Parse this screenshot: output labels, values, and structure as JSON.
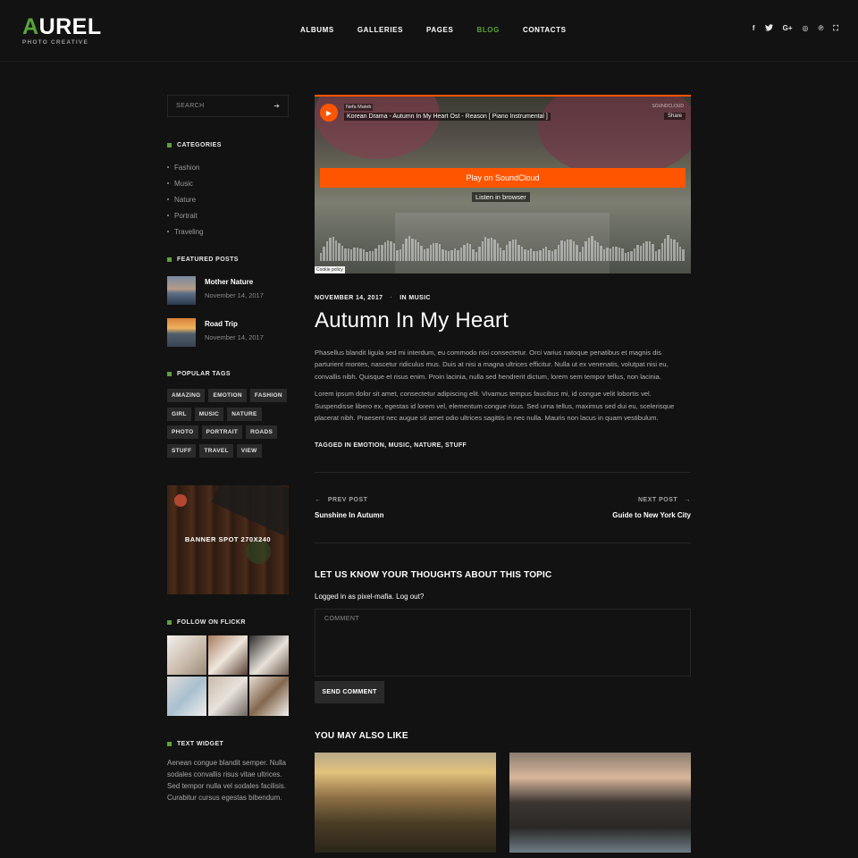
{
  "header": {
    "logo_first": "A",
    "logo_rest": "UREL",
    "logo_sub": "PHOTO CREATIVE",
    "nav": [
      {
        "label": "ALBUMS",
        "active": false
      },
      {
        "label": "GALLERIES",
        "active": false
      },
      {
        "label": "PAGES",
        "active": false
      },
      {
        "label": "BLOG",
        "active": true
      },
      {
        "label": "CONTACTS",
        "active": false
      }
    ],
    "social": {
      "facebook": "f",
      "twitter": "t",
      "google": "G+",
      "instagram": "◎",
      "pinterest": "℗",
      "fullscreen": "⛶"
    }
  },
  "sidebar": {
    "search_placeholder": "SEARCH",
    "search_arrow": "➔",
    "categories_title": "CATEGORIES",
    "categories": [
      "Fashion",
      "Music",
      "Nature",
      "Portrait",
      "Traveling"
    ],
    "featured_title": "FEATURED POSTS",
    "featured": [
      {
        "title": "Mother Nature",
        "date": "November 14, 2017"
      },
      {
        "title": "Road Trip",
        "date": "November 14, 2017"
      }
    ],
    "tags_title": "POPULAR TAGS",
    "tags": [
      "AMAZING",
      "EMOTION",
      "FASHION",
      "GIRL",
      "MUSIC",
      "NATURE",
      "PHOTO",
      "PORTRAIT",
      "ROADS",
      "STUFF",
      "TRAVEL",
      "VIEW"
    ],
    "banner_text": "BANNER SPOT 270X240",
    "flickr_title": "FOLLOW ON FLICKR",
    "text_widget_title": "TEXT WIDGET",
    "text_widget_body": "Aenean congue blandit semper. Nulla sodales convallis risus vitae ultrices. Sed tempor nulla vel sodales facilisis. Curabitur cursus egestas bibendum."
  },
  "player": {
    "artist": "Nefa Mateb",
    "track": "Korean Drama - Autumn In My Heart Ost - Reason [ Piano Instrumental ]",
    "logo": "SOUNDCLOUD",
    "share": "Share",
    "play_label": "Play on SoundCloud",
    "listen_label": "Listen in browser",
    "cookie": "Cookie policy"
  },
  "post": {
    "date": "NOVEMBER 14, 2017",
    "separator": "·",
    "category": "IN MUSIC",
    "title": "Autumn In My Heart",
    "paragraph_1": "Phasellus blandit ligula sed mi interdum, eu commodo nisi consectetur. Orci varius natoque penatibus et magnis dis parturient montes, nascetur ridiculus mus. Duis at nisi a magna ultrices efficitur. Nulla ut ex venenatis, volutpat nisi eu, convallis nibh. Quisque et risus enim. Proin lacinia, nulla sed hendrerit dictum, lorem sem tempor tellus, non lacinia.",
    "paragraph_2": "Lorem ipsum dolor sit amet, consectetur adipiscing elit. Vivamus tempus faucibus mi, id congue velit lobortis vel. Suspendisse libero ex, egestas id lorem vel, elementum congue risus. Sed urna tellus, maximus sed dui eu, scelerisque placerat nibh. Praesent nec augue sit amet odio ultrices sagittis in nec nulla. Mauris non lacus in quam vestibulum.",
    "tagged": "TAGGED IN EMOTION, MUSIC, NATURE, STUFF"
  },
  "post_nav": {
    "prev_label": "PREV POST",
    "prev_title": "Sunshine In Autumn",
    "next_label": "NEXT POST",
    "next_title": "Guide to New York City"
  },
  "comments": {
    "heading": "LET US KNOW YOUR THOUGHTS ABOUT THIS TOPIC",
    "logged_in": "Logged in as pixel-mafia. Log out?",
    "placeholder": "COMMENT",
    "send_label": "SEND COMMENT"
  },
  "related": {
    "heading": "YOU MAY ALSO LIKE"
  },
  "colors": {
    "accent": "#5aa33b",
    "soundcloud": "#ff5500",
    "background": "#121212"
  }
}
